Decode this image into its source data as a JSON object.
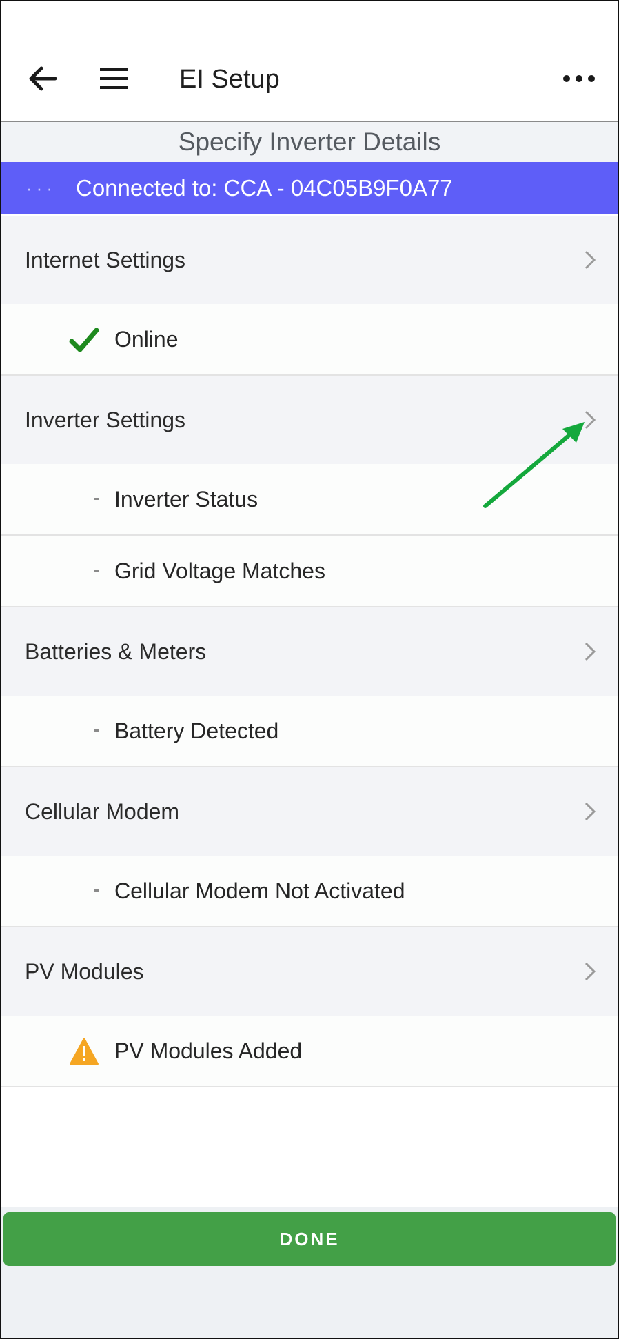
{
  "header": {
    "title": "EI Setup",
    "back_icon": "arrow-left-icon",
    "menu_icon": "hamburger-menu-icon",
    "more_icon": "more-horizontal-icon"
  },
  "subheader": {
    "title": "Specify Inverter Details"
  },
  "connection": {
    "dots": "···",
    "text": "Connected to: CCA - 04C05B9F0A77",
    "color": "#5e5ef8"
  },
  "sections": [
    {
      "label": "Internet Settings",
      "items": [
        {
          "label": "Online",
          "status": "success"
        }
      ]
    },
    {
      "label": "Inverter Settings",
      "items": [
        {
          "label": "Inverter Status",
          "status": "none"
        },
        {
          "label": "Grid Voltage Matches",
          "status": "none"
        }
      ]
    },
    {
      "label": "Batteries & Meters",
      "items": [
        {
          "label": "Battery Detected",
          "status": "none"
        }
      ]
    },
    {
      "label": "Cellular Modem",
      "items": [
        {
          "label": "Cellular Modem Not Activated",
          "status": "none"
        }
      ]
    },
    {
      "label": "PV Modules",
      "items": [
        {
          "label": "PV Modules Added",
          "status": "warning"
        }
      ]
    }
  ],
  "done": {
    "label": "DONE",
    "color": "#43a047"
  },
  "colors": {
    "success": "#1e8a1e",
    "warning": "#f5a623",
    "annotation_arrow": "#14a83c"
  }
}
